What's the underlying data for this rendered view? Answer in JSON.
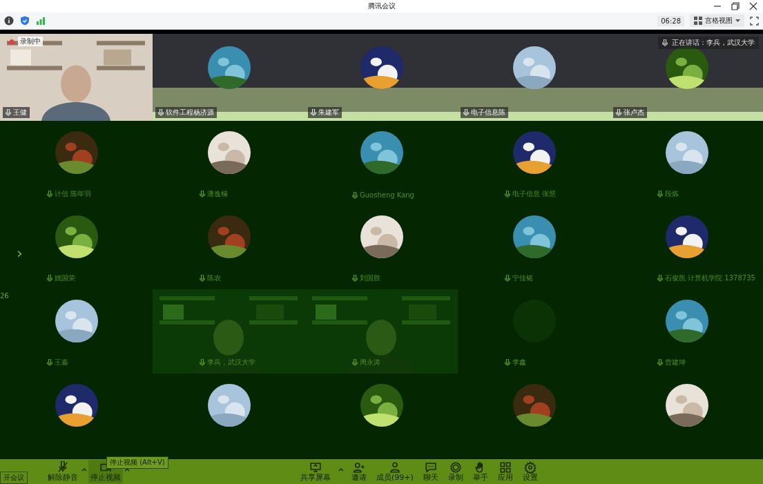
{
  "window": {
    "title": "腾讯会议"
  },
  "topbar": {
    "time": "06:28",
    "view_mode": "宫格视图"
  },
  "recording": {
    "label": "录制中"
  },
  "speaking": {
    "label": "正在讲话：李兵，武汉大学"
  },
  "rows": [
    [
      {
        "kind": "video",
        "name": "王健"
      },
      {
        "kind": "avatar",
        "name": "软件工程杨济源"
      },
      {
        "kind": "avatar",
        "name": "朱建军"
      },
      {
        "kind": "avatar",
        "name": "电子信息陈"
      },
      {
        "kind": "avatar",
        "name": "张卢杰"
      }
    ],
    [
      {
        "kind": "avatar",
        "name": "计信 陈年羽"
      },
      {
        "kind": "avatar",
        "name": "潘逸楠"
      },
      {
        "kind": "avatar",
        "name": "Guosheng Kang"
      },
      {
        "kind": "avatar",
        "name": "电子信息 张慧"
      },
      {
        "kind": "avatar",
        "name": "段炼"
      }
    ],
    [
      {
        "kind": "avatar",
        "name": "姚国荣"
      },
      {
        "kind": "avatar",
        "name": "陈农"
      },
      {
        "kind": "avatar",
        "name": "刘国胜"
      },
      {
        "kind": "avatar",
        "name": "宁佳铭"
      },
      {
        "kind": "avatar",
        "name": "石俊凯 计算机学院 1378735"
      }
    ],
    [
      {
        "kind": "avatar",
        "name": "王淼"
      },
      {
        "kind": "video",
        "name": "李兵，武汉大学"
      },
      {
        "kind": "video",
        "name": "周永涛"
      },
      {
        "kind": "blank",
        "name": "李鑫"
      },
      {
        "kind": "avatar",
        "name": "曾建坤"
      }
    ],
    [
      {
        "kind": "avatar"
      },
      {
        "kind": "avatar"
      },
      {
        "kind": "avatar"
      },
      {
        "kind": "avatar"
      },
      {
        "kind": "avatar"
      }
    ]
  ],
  "page_arrow": "›",
  "page_number": "26",
  "leave": "开会议",
  "tooltip": "停止视频 (Alt+V)",
  "left_controls": [
    {
      "kind": "mic-off",
      "label": "解除静音",
      "menu": true
    },
    {
      "kind": "camera",
      "label": "停止视频",
      "menu": true
    }
  ],
  "center_controls": [
    {
      "kind": "share",
      "label": "共享屏幕",
      "menu": true
    },
    {
      "kind": "invite",
      "label": "邀请",
      "menu": false
    },
    {
      "kind": "members",
      "label": "成员(99+)",
      "menu": false
    },
    {
      "kind": "chat",
      "label": "聊天",
      "menu": false
    },
    {
      "kind": "record",
      "label": "录制",
      "menu": false
    },
    {
      "kind": "hand",
      "label": "举手",
      "menu": false
    },
    {
      "kind": "apps",
      "label": "应用",
      "menu": false
    },
    {
      "kind": "settings",
      "label": "设置",
      "menu": false
    }
  ]
}
